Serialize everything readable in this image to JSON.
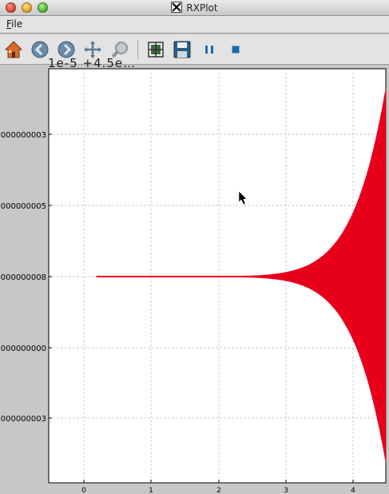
{
  "window": {
    "title": "RXPlot"
  },
  "menu": {
    "file_first": "F",
    "file_rest": "ile"
  },
  "toolbar": {
    "buttons": [
      {
        "name": "home",
        "icon": "home-icon"
      },
      {
        "name": "back",
        "icon": "back-arrow-icon"
      },
      {
        "name": "forward",
        "icon": "forward-arrow-icon"
      },
      {
        "name": "pan",
        "icon": "move-icon"
      },
      {
        "name": "zoom",
        "icon": "zoom-rect-icon"
      },
      {
        "name": "configure",
        "icon": "subplots-icon"
      },
      {
        "name": "save",
        "icon": "floppy-disk-icon"
      },
      {
        "name": "pause",
        "icon": "pause-icon"
      },
      {
        "name": "stop",
        "icon": "stop-icon"
      }
    ]
  },
  "plot": {
    "offset_label": "1e-5 +4.5e…",
    "x_ticks": [
      "0",
      "1",
      "2",
      "3",
      "4"
    ],
    "y_ticks": [
      "000000003",
      "000000005",
      "000000008",
      "000000000",
      "000000003"
    ],
    "fill_color": "#e8001b",
    "grid": true
  }
}
